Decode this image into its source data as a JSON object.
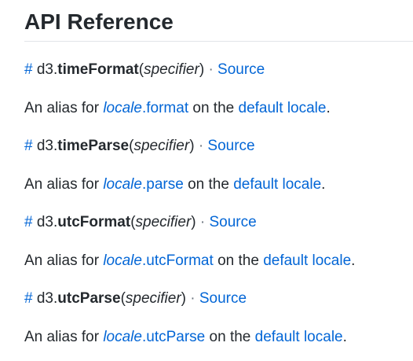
{
  "heading": "API Reference",
  "entries": [
    {
      "hash": "#",
      "prefix": "d3.",
      "name": "timeFormat",
      "open_paren": "(",
      "arg": "specifier",
      "close_paren": ")",
      "separator": "·",
      "source_label": "Source",
      "desc_before": "An alias for ",
      "locale_word": "locale",
      "method": ".format",
      "desc_middle": " on the ",
      "default_locale": "default locale",
      "desc_end": "."
    },
    {
      "hash": "#",
      "prefix": "d3.",
      "name": "timeParse",
      "open_paren": "(",
      "arg": "specifier",
      "close_paren": ")",
      "separator": "·",
      "source_label": "Source",
      "desc_before": "An alias for ",
      "locale_word": "locale",
      "method": ".parse",
      "desc_middle": " on the ",
      "default_locale": "default locale",
      "desc_end": "."
    },
    {
      "hash": "#",
      "prefix": "d3.",
      "name": "utcFormat",
      "open_paren": "(",
      "arg": "specifier",
      "close_paren": ")",
      "separator": "·",
      "source_label": "Source",
      "desc_before": "An alias for ",
      "locale_word": "locale",
      "method": ".utcFormat",
      "desc_middle": " on the ",
      "default_locale": "default locale",
      "desc_end": "."
    },
    {
      "hash": "#",
      "prefix": "d3.",
      "name": "utcParse",
      "open_paren": "(",
      "arg": "specifier",
      "close_paren": ")",
      "separator": "·",
      "source_label": "Source",
      "desc_before": "An alias for ",
      "locale_word": "locale",
      "method": ".utcParse",
      "desc_middle": " on the ",
      "default_locale": "default locale",
      "desc_end": "."
    }
  ]
}
